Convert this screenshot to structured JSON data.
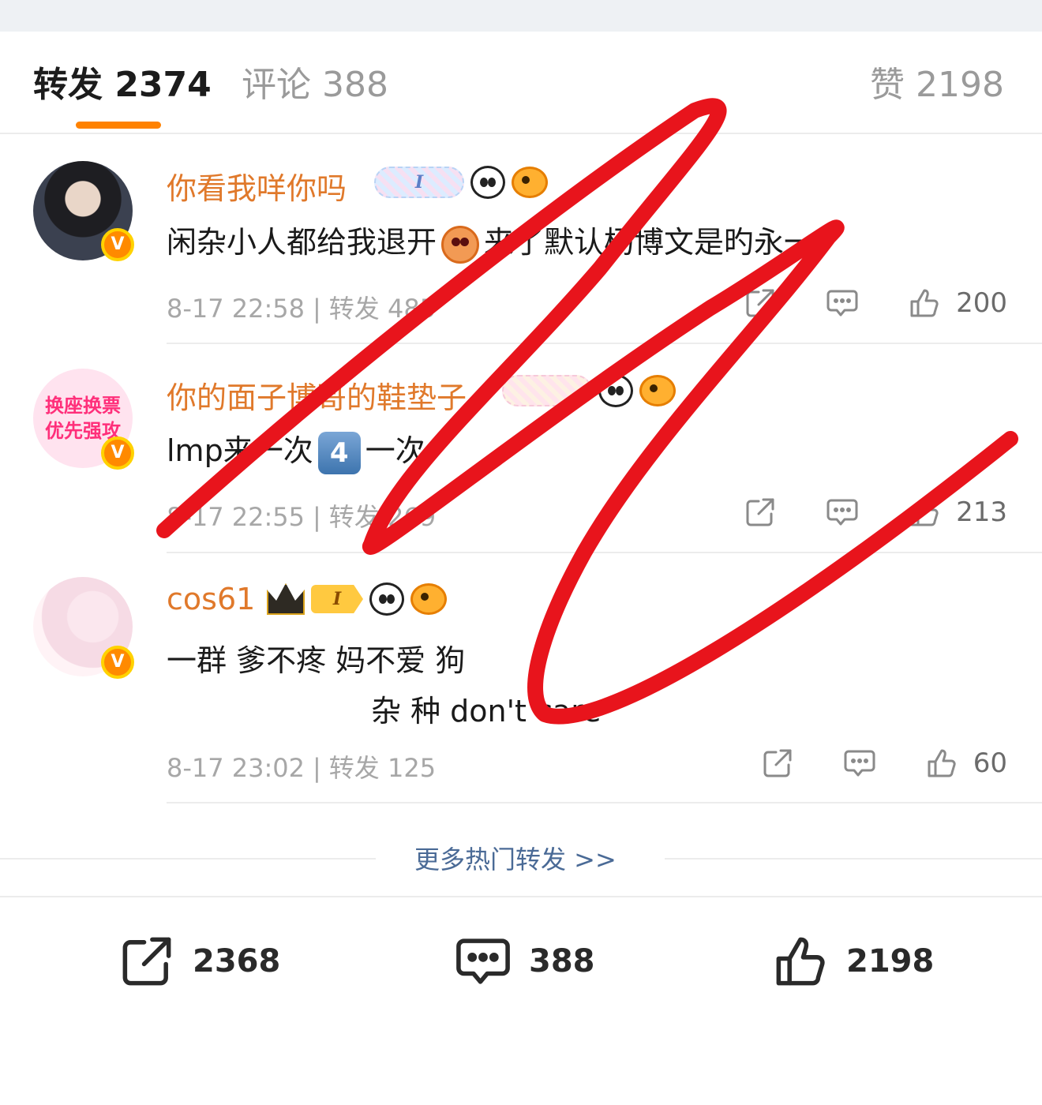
{
  "tabs": {
    "reposts": "转发 2374",
    "comments": "评论 388",
    "likes": "赞 2198"
  },
  "items": [
    {
      "username": "你看我咩你吗",
      "badge_level": "I",
      "content_before": "闲杂小人都给我退开",
      "content_after": "来了默认杨博文是旳永一",
      "time": "8-17 22:58",
      "repost_label": "转发 485",
      "likes": "200"
    },
    {
      "username": "你的面子博哥的鞋垫子",
      "avatar_text": "换座换票 优先强攻",
      "content_before": "lmp来一次",
      "keycap": "4",
      "content_after": "一次",
      "time": "8-17 22:55",
      "repost_label": "转发 269",
      "likes": "213"
    },
    {
      "username": "cos61",
      "badge_level": "I",
      "content_line1": "一群 爹不疼 妈不爱 狗",
      "content_line2": "杂 种 don't care",
      "time": "8-17 23:02",
      "repost_label": "转发 125",
      "likes": "60"
    }
  ],
  "more_link": "更多热门转发 >>",
  "bottom_bar": {
    "reposts": "2368",
    "comments": "388",
    "likes": "2198"
  },
  "colors": {
    "accent": "#ff8200",
    "username": "#e0792b",
    "link": "#4a6a96",
    "scribble": "#e8141c"
  },
  "icons": [
    "share-icon",
    "comment-icon",
    "like-icon",
    "verified-icon",
    "panda-icon",
    "fish-icon",
    "crown-icon"
  ]
}
